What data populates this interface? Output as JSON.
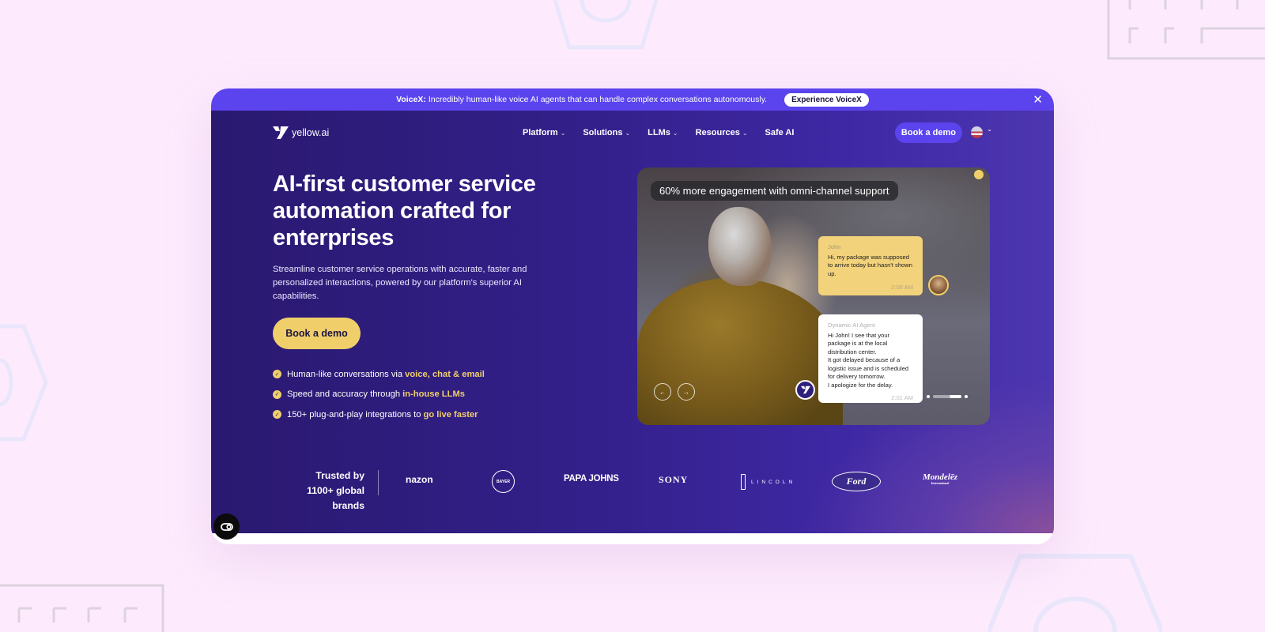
{
  "announcement": {
    "label": "VoiceX:",
    "text": "Incredibly human-like voice AI agents that can handle complex conversations autonomously.",
    "button": "Experience VoiceX",
    "close_icon": "close-icon"
  },
  "nav": {
    "logo_text": "yellow.ai",
    "items": [
      {
        "label": "Platform",
        "has_dropdown": true
      },
      {
        "label": "Solutions",
        "has_dropdown": true
      },
      {
        "label": "LLMs",
        "has_dropdown": true
      },
      {
        "label": "Resources",
        "has_dropdown": true
      },
      {
        "label": "Safe AI",
        "has_dropdown": false
      }
    ],
    "chevron": "⌄",
    "cta": "Book a demo",
    "language_icon": "us-flag-icon"
  },
  "hero": {
    "title": "AI-first customer service automation crafted for enterprises",
    "subtitle": "Streamline customer service operations with accurate, faster and personalized interactions, powered by our platform's superior AI capabilities.",
    "cta": "Book a demo",
    "bullets": [
      {
        "text": "Human-like conversations via",
        "highlight": "voice, chat & email"
      },
      {
        "text": "Speed and accuracy through",
        "highlight": "in-house LLMs"
      },
      {
        "text": "150+ plug-and-play integrations to",
        "highlight": "go live faster"
      }
    ],
    "check_glyph": "✓"
  },
  "media": {
    "stat": "60% more engagement with omni-channel support",
    "user_message": {
      "sender": "John",
      "text": "Hi, my package was supposed to arrive today but hasn't shown up.",
      "time": "2:00 AM"
    },
    "agent_message": {
      "sender": "Dynamic AI Agent",
      "lines": [
        "Hi John! I see that your package is at the local distribution center.",
        "It got delayed because of a logistic issue and is scheduled for delivery tomorrow.",
        "I apologize for the delay."
      ],
      "time": "2:01 AM"
    },
    "prev_glyph": "←",
    "next_glyph": "→"
  },
  "trusted": {
    "line1": "Trusted by",
    "line2": "1100+ global brands",
    "brands": {
      "amazon": "nazon",
      "bayer": "BAYER",
      "papajohns": "PAPA JOHNS",
      "sony": "SONY",
      "lincoln": "LINCOLN",
      "ford": "Ford",
      "mondelez": "Mondelēz",
      "mondelez_sub": "International"
    }
  },
  "colors": {
    "accent_purple": "#5b44ee",
    "hero_dark": "#2a1970",
    "accent_yellow": "#f0cf6b",
    "page_bg": "#fdebfd"
  }
}
